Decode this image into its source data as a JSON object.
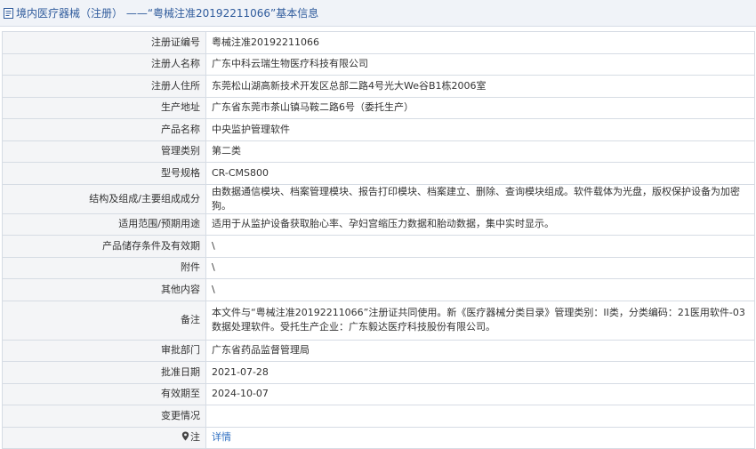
{
  "header": {
    "title": "境内医疗器械（注册） ——“粤械注准20192211066”基本信息"
  },
  "rows": [
    {
      "key": "注册证编号",
      "value": "粤械注准20192211066"
    },
    {
      "key": "注册人名称",
      "value": "广东中科云瑞生物医疗科技有限公司"
    },
    {
      "key": "注册人住所",
      "value": "东莞松山湖高新技术开发区总部二路4号光大We谷B1栋2006室"
    },
    {
      "key": "生产地址",
      "value": "广东省东莞市茶山镇马鞍二路6号（委托生产）"
    },
    {
      "key": "产品名称",
      "value": "中央监护管理软件"
    },
    {
      "key": "管理类别",
      "value": "第二类"
    },
    {
      "key": "型号规格",
      "value": "CR-CMS800"
    },
    {
      "key": "结构及组成/主要组成成分",
      "value": "由数据通信模块、档案管理模块、报告打印模块、档案建立、删除、查询模块组成。软件载体为光盘，版权保护设备为加密狗。"
    },
    {
      "key": "适用范围/预期用途",
      "value": "适用于从监护设备获取胎心率、孕妇宫缩压力数据和胎动数据，集中实时显示。"
    },
    {
      "key": "产品储存条件及有效期",
      "value": "\\"
    },
    {
      "key": "附件",
      "value": "\\"
    },
    {
      "key": "其他内容",
      "value": "\\"
    },
    {
      "key": "备注",
      "value": "本文件与“粤械注准20192211066”注册证共同使用。新《医疗器械分类目录》管理类别：II类，分类编码：21医用软件-03数据处理软件。受托生产企业：广东毅达医疗科技股份有限公司。"
    },
    {
      "key": "审批部门",
      "value": "广东省药品监督管理局"
    },
    {
      "key": "批准日期",
      "value": "2021-07-28"
    },
    {
      "key": "有效期至",
      "value": "2024-10-07"
    },
    {
      "key": "变更情况",
      "value": ""
    }
  ],
  "note_row": {
    "key": "注",
    "link_label": "详情"
  }
}
